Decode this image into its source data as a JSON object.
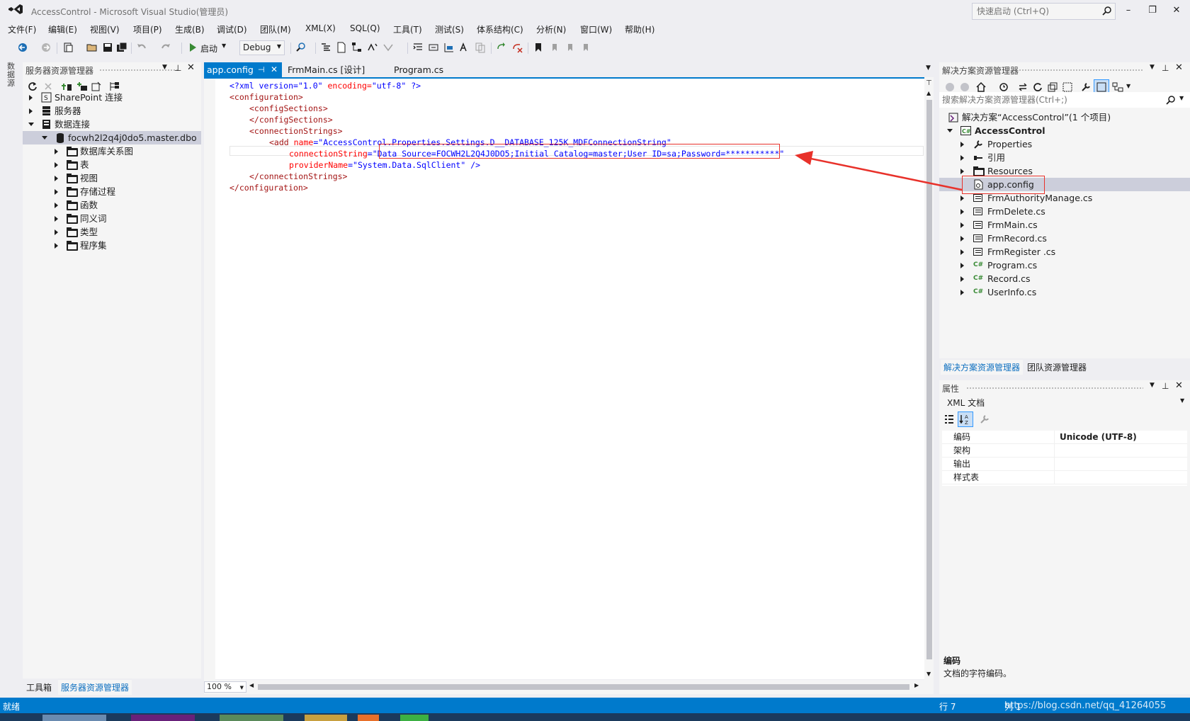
{
  "window": {
    "title": "AccessControl - Microsoft Visual Studio(管理员)",
    "quick_launch_placeholder": "快速启动 (Ctrl+Q)",
    "minimize": "–",
    "restore": "❐",
    "close": "✕"
  },
  "menu": [
    "文件(F)",
    "编辑(E)",
    "视图(V)",
    "项目(P)",
    "生成(B)",
    "调试(D)",
    "团队(M)",
    "XML(X)",
    "SQL(Q)",
    "工具(T)",
    "测试(S)",
    "体系结构(C)",
    "分析(N)",
    "窗口(W)",
    "帮助(H)"
  ],
  "toolbar": {
    "start_label": "启动",
    "config_value": "Debug"
  },
  "left_strip": {
    "label": "数据源"
  },
  "server_explorer": {
    "title": "服务器资源管理器",
    "tree": [
      {
        "label": "SharePoint 连接"
      },
      {
        "label": "服务器"
      },
      {
        "label": "数据连接"
      },
      {
        "label": "focwh2l2q4j0do5.master.dbo"
      },
      {
        "label": "数据库关系图"
      },
      {
        "label": "表"
      },
      {
        "label": "视图"
      },
      {
        "label": "存储过程"
      },
      {
        "label": "函数"
      },
      {
        "label": "同义词"
      },
      {
        "label": "类型"
      },
      {
        "label": "程序集"
      }
    ],
    "bottom_tabs": [
      "工具箱",
      "服务器资源管理器"
    ]
  },
  "editor": {
    "tabs": [
      {
        "label": "app.config",
        "pin": "⊣",
        "close": "✕"
      },
      {
        "label": "FrmMain.cs [设计]"
      },
      {
        "label": "Program.cs"
      }
    ],
    "lines": {
      "l1_a": "<?xml version=",
      "l1_b": "\"1.0\"",
      "l1_c": " encoding=",
      "l1_d": "\"utf-8\"",
      "l1_e": " ?>",
      "l2": "<configuration>",
      "l3": "<configSections>",
      "l4": "</configSections>",
      "l5": "<connectionStrings>",
      "l6_a": "<add ",
      "l6_b": "name",
      "l6_c": "=",
      "l6_d": "\"AccessControl.Properties.Settings.D__DATABASE_125K_MDFConnectionString\"",
      "l7_a": "connectionString",
      "l7_b": "=",
      "l7_c": "\"Data Source=FOCWH2L2Q4J0DO5;Initial Catalog=master;User ID=sa;Password=***********\"",
      "l8_a": "providerName",
      "l8_b": "=",
      "l8_c": "\"System.Data.SqlClient\"",
      "l8_d": " />",
      "l9": "</connectionStrings>",
      "l10": "</configuration>"
    },
    "zoom": "100 %"
  },
  "solution_explorer": {
    "title": "解决方案资源管理器",
    "search_placeholder": "搜索解决方案资源管理器(Ctrl+;)",
    "solution_label": "解决方案“AccessControl”(1 个项目)",
    "project": "AccessControl",
    "items": [
      {
        "label": "Properties"
      },
      {
        "label": "引用"
      },
      {
        "label": "Resources"
      },
      {
        "label": "app.config"
      },
      {
        "label": "FrmAuthorityManage.cs"
      },
      {
        "label": "FrmDelete.cs"
      },
      {
        "label": "FrmMain.cs"
      },
      {
        "label": "FrmRecord.cs"
      },
      {
        "label": "FrmRegister .cs"
      },
      {
        "label": "Program.cs"
      },
      {
        "label": "Record.cs"
      },
      {
        "label": "UserInfo.cs"
      }
    ],
    "bottom_tabs": [
      "解决方案资源管理器",
      "团队资源管理器"
    ]
  },
  "properties": {
    "title": "属性",
    "object": "XML 文档",
    "rows": [
      {
        "name": "编码",
        "value": "Unicode (UTF-8)"
      },
      {
        "name": "架构",
        "value": ""
      },
      {
        "name": "输出",
        "value": ""
      },
      {
        "name": "样式表",
        "value": ""
      }
    ],
    "desc_title": "编码",
    "desc_text": "文档的字符编码。"
  },
  "status": {
    "left": "就绪",
    "line": "行 7",
    "col": "列 1",
    "watermark": "https://blog.csdn.net/qq_41264055"
  },
  "colors": {
    "accent": "#007ACC",
    "annotation": "#E8312A"
  }
}
